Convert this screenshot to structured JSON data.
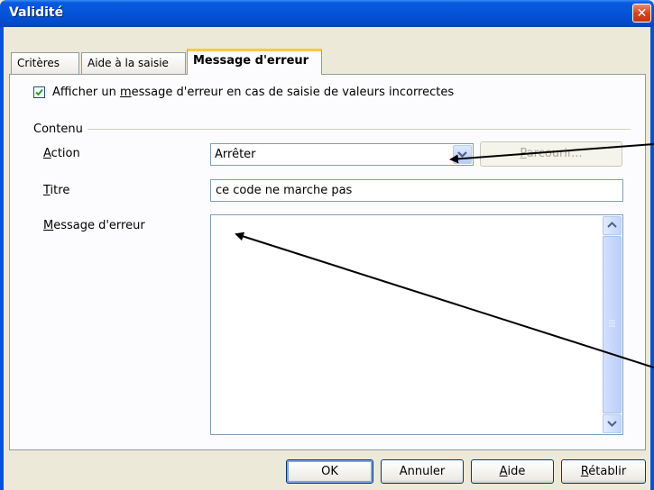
{
  "window": {
    "title": "Validité",
    "close_glyph": "✕"
  },
  "tabs": [
    {
      "label": "Critères"
    },
    {
      "label": "Aide à la saisie"
    },
    {
      "label": "Message d'erreur"
    }
  ],
  "checkbox": {
    "checked": true,
    "label_pre": "Afficher un ",
    "label_accel": "m",
    "label_post": "essage d'erreur en cas de saisie de valeurs incorrectes"
  },
  "group": {
    "label": "Contenu"
  },
  "fields": {
    "action_label_accel": "A",
    "action_label_rest": "ction",
    "action_value": "Arrêter",
    "browse_accel": "P",
    "browse_rest": "arcourir...",
    "title_label_accel": "T",
    "title_label_rest": "itre",
    "title_value": "ce code ne marche pas",
    "message_label_accel": "M",
    "message_label_rest": "essage d'erreur",
    "message_value": ""
  },
  "buttons": {
    "ok": "OK",
    "cancel": "Annuler",
    "help_accel": "A",
    "help_rest": "ide",
    "reset_accel": "R",
    "reset_rest": "établir"
  }
}
